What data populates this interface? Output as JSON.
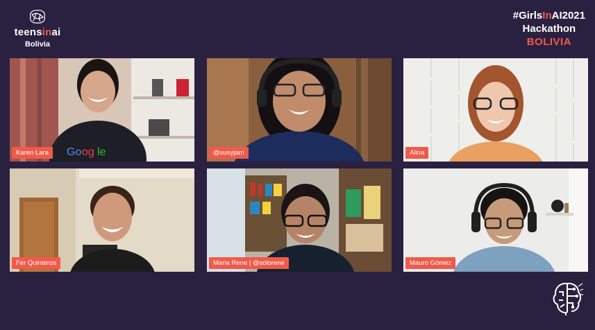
{
  "brand": {
    "name_pre": "teens",
    "name_hl": "in",
    "name_post": "ai",
    "subtitle": "Bolivia"
  },
  "event": {
    "hashtag_pre": "#Girls",
    "hashtag_hl": "In",
    "hashtag_post": "AI2021",
    "title": "Hackathon",
    "country": "BOLIVIA"
  },
  "participants": [
    {
      "name": "Karen Lara"
    },
    {
      "name": "@susyjam"
    },
    {
      "name": "Alina"
    },
    {
      "name": "Fer Quinteros"
    },
    {
      "name": "Maria Rene | @solorene"
    },
    {
      "name": "Mauro Gómez"
    }
  ],
  "colors": {
    "background": "#2a2140",
    "accent": "#f05a4a"
  }
}
